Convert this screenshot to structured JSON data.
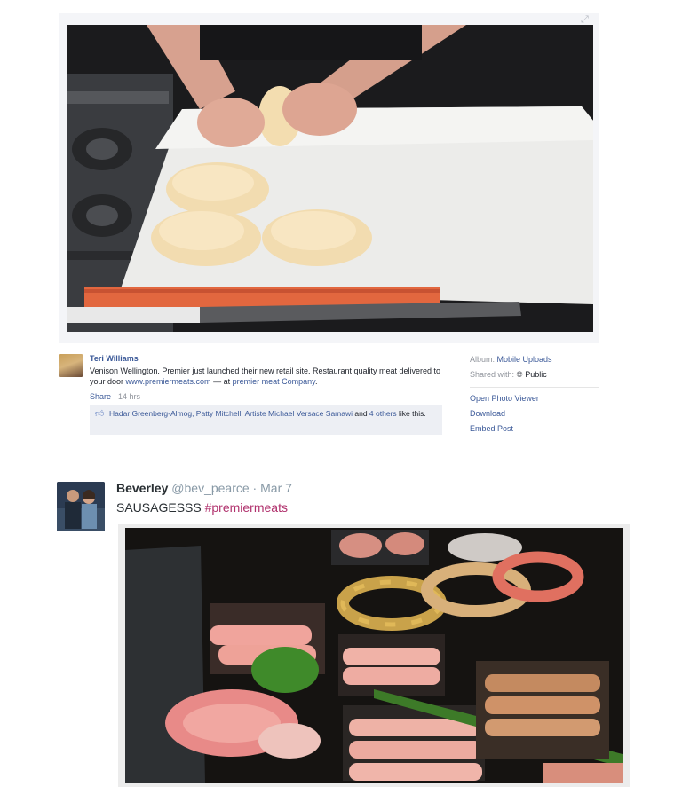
{
  "facebook_post": {
    "author": "Teri Williams",
    "text_main": "Venison Wellington. Premier just launched their new retail site. Restaurant quality meat delivered to your door ",
    "url": "www.premiermeats.com",
    "text_at": " — at ",
    "place": "premier meat Company",
    "text_end": ".",
    "share": "Share",
    "time": " · 14 hrs",
    "likes": {
      "names": "Hadar Greenberg-Almog, Patty Mitchell, Artiste Michael Versace Samawi",
      "and": " and ",
      "others": "4 others",
      "suffix": " like this."
    },
    "sidebar": {
      "album_label": "Album: ",
      "album_value": "Mobile Uploads",
      "shared_label": "Shared with: ",
      "shared_value": "Public",
      "open_viewer": "Open Photo Viewer",
      "download": "Download",
      "embed": "Embed Post"
    },
    "icons": [
      "expand-icon",
      "like-icon",
      "globe-icon"
    ]
  },
  "tweet": {
    "name": "Beverley",
    "handle": "@bev_pearce",
    "separator": " · ",
    "date": "Mar 7",
    "text": "SAUSAGESSS ",
    "hashtag": "#premiermeats",
    "hashtag_color": "#b0306c"
  },
  "colors": {
    "fb_link": "#3b5998",
    "fb_meta": "#90949c",
    "like_bar": "#edeff4"
  }
}
